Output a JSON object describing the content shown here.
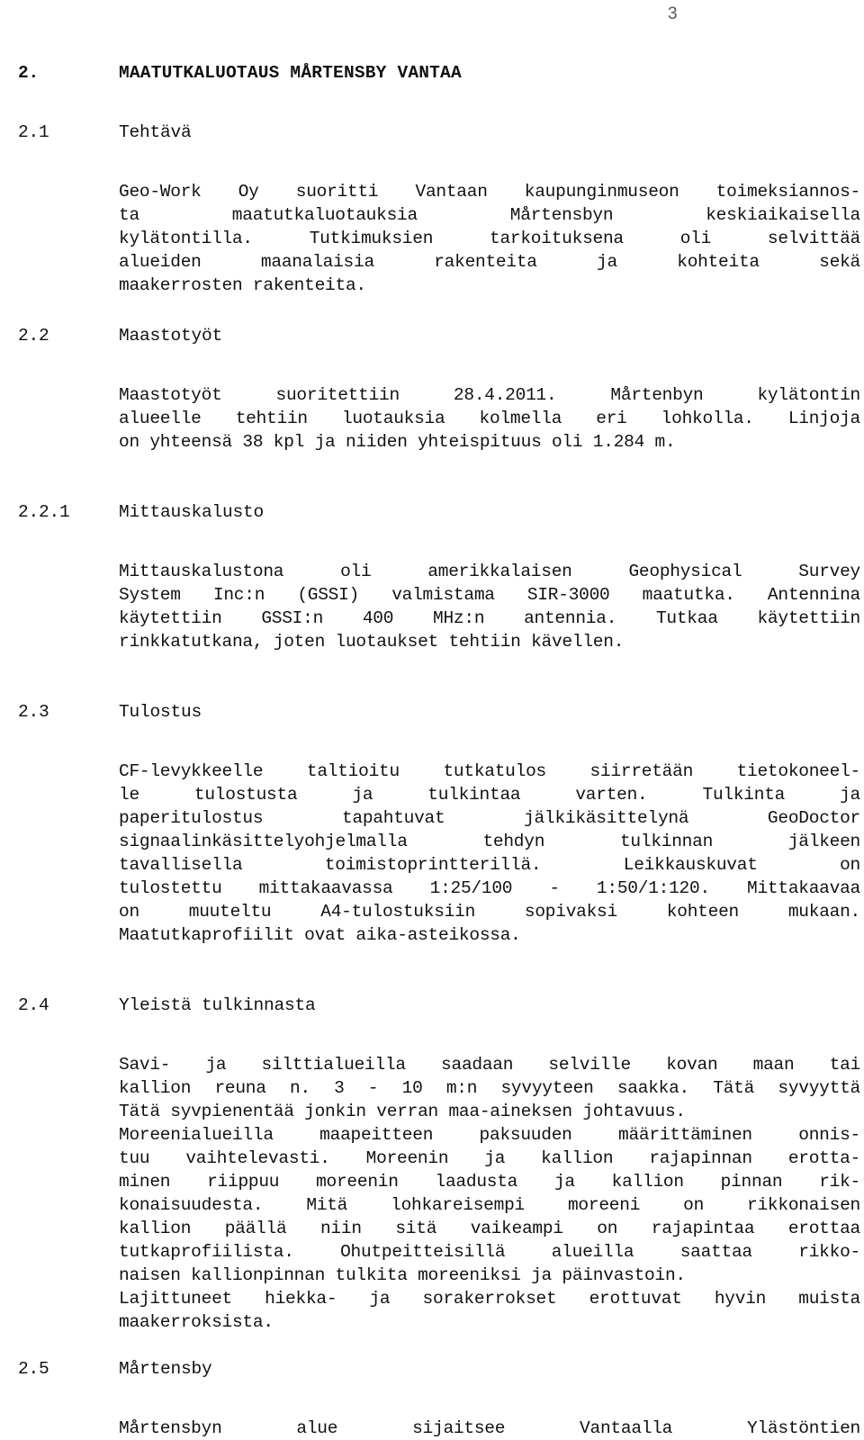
{
  "document": {
    "page_number": "3",
    "language": "fi"
  },
  "sections": [
    {
      "number": "2.",
      "title": "MAATUTKALUOTAUS MÅRTENSBY VANTAA",
      "level": "major"
    },
    {
      "number": "2.1",
      "title": "Tehtävä",
      "level": "sub",
      "paragraph_lines": [
        "Geo-Work Oy suoritti Vantaan kaupunginmuseon toimeksiannos-",
        "ta maatutkaluotauksia Mårtensbyn keskiaikaisella",
        "kylätontilla. Tutkimuksien tarkoituksena oli selvittää",
        "alueiden maanalaisia rakenteita ja kohteita sekä",
        "maakerrosten rakenteita."
      ]
    },
    {
      "number": "2.2",
      "title": "Maastotyöt",
      "level": "sub",
      "paragraph_lines": [
        "Maastotyöt suoritettiin 28.4.2011. Mårtenbyn kylätontin",
        "alueelle tehtiin luotauksia kolmella eri lohkolla. Linjoja",
        "on yhteensä 38 kpl ja niiden yhteispituus oli 1.284 m."
      ]
    },
    {
      "number": "2.2.1",
      "title": "Mittauskalusto",
      "level": "sub",
      "paragraph_lines": [
        "Mittauskalustona oli amerikkalaisen Geophysical Survey",
        "System Inc:n (GSSI) valmistama SIR-3000 maatutka. Antennina",
        "käytettiin GSSI:n 400 MHz:n antennia. Tutkaa käytettiin",
        "rinkkatutkana, joten luotaukset tehtiin kävellen."
      ]
    },
    {
      "number": "2.3",
      "title": "Tulostus",
      "level": "sub",
      "paragraph_lines": [
        "CF-levykkeelle taltioitu tutkatulos siirretään tietokoneel-",
        "le tulostusta ja tulkintaa varten. Tulkinta ja",
        "paperitulostus tapahtuvat jälkikäsittelynä GeoDoctor",
        "signaalinkäsittelyohjelmalla tehdyn tulkinnan jälkeen",
        "tavallisella toimistoprintterillä. Leikkauskuvat on",
        "tulostettu mittakaavassa 1:25/100 - 1:50/1:120. Mittakaavaa",
        "on muuteltu A4-tulostuksiin sopivaksi kohteen mukaan.",
        "Maatutkaprofiilit ovat aika-asteikossa."
      ]
    },
    {
      "number": "2.4",
      "title": "Yleistä tulkinnasta",
      "level": "sub",
      "paragraph_lines": [
        "Savi- ja silttialueilla saadaan selville kovan maan tai",
        "kallion reuna n. 3 - 10 m:n syvyyteen saakka. Tätä syvyyttä",
        "Tätä syvpienentää jonkin verran maa-aineksen johtavuus.",
        "Moreenialueilla maapeitteen paksuuden määrittäminen onnis-",
        "tuu vaihtelevasti. Moreenin ja kallion rajapinnan erotta-",
        "minen riippuu moreenin laadusta ja kallion pinnan rik-",
        "konaisuudesta. Mitä lohkareisempi moreeni on rikkonaisen",
        "kallion päällä niin sitä vaikeampi on rajapintaa erottaa",
        "tutkaprofiilista. Ohutpeitteisillä alueilla saattaa rikko-",
        "naisen kallionpinnan tulkita moreeniksi ja päinvastoin.",
        "Lajittuneet hiekka- ja sorakerrokset erottuvat hyvin muista",
        "maakerroksista."
      ]
    },
    {
      "number": "2.5",
      "title": "Mårtensby",
      "level": "sub",
      "paragraph_lines": [
        "Mårtensbyn alue sijaitsee Vantaalla Ylästöntien"
      ]
    }
  ]
}
